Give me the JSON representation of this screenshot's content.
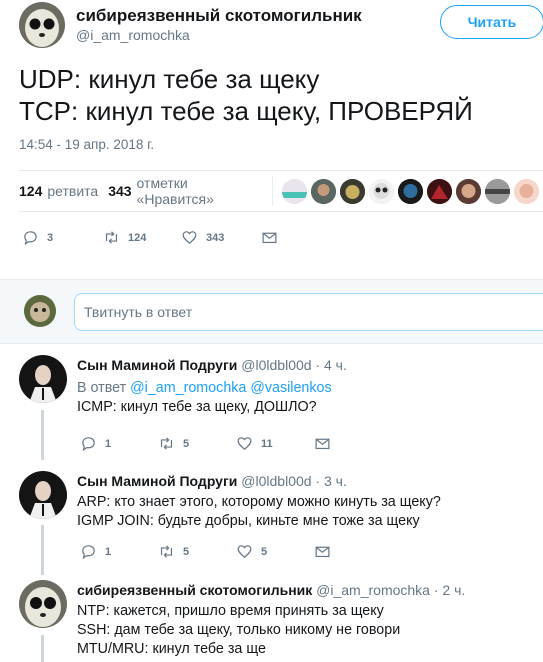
{
  "tweet": {
    "author_name": "сибиреязвенный скотомогильник",
    "author_handle": "@i_am_romochka",
    "follow_label": "Читать",
    "text_line1": "UDP: кинул тебе за щеку",
    "text_line2": "TCP: кинул тебе за щеку, ПРОВЕРЯЙ",
    "time": "14:54 - 19 апр. 2018 г.",
    "retweets_count": "124",
    "retweets_label": "ретвита",
    "likes_count": "343",
    "likes_label": "отметки «Нравится»",
    "actions": {
      "replies": "3",
      "retweets": "124",
      "likes": "343"
    }
  },
  "reply_box": {
    "placeholder": "Твитнуть в ответ"
  },
  "replies": [
    {
      "name": "Сын Маминой Подруги",
      "handle": "@l0ldbl00d",
      "time": "· 4 ч.",
      "in_reply_prefix": "В ответ",
      "in_reply_users": "@i_am_romochka @vasilenkos",
      "lines": [
        "ICMP: кинул тебе за щеку, ДОШЛО?"
      ],
      "replies": "1",
      "retweets": "5",
      "likes": "11"
    },
    {
      "name": "Сын Маминой Подруги",
      "handle": "@l0ldbl00d",
      "time": "· 3 ч.",
      "lines": [
        "ARP: кто знает этого, которому можно кинуть за щеку?",
        "IGMP JOIN: будьте добры, киньте мне тоже за щеку"
      ],
      "replies": "1",
      "retweets": "5",
      "likes": "5"
    },
    {
      "name": "сибиреязвенный скотомогильник",
      "handle": "@i_am_romochka",
      "time": "· 2 ч.",
      "lines": [
        "NTP: кажется, пришло время принять за щеку",
        "SSH: дам тебе за щеку, только никому не говори",
        "MTU/MRU: кинул тебе за ще"
      ]
    }
  ],
  "colors": {
    "accent": "#1da1f2",
    "muted": "#657786",
    "border": "#e6ecf0"
  }
}
